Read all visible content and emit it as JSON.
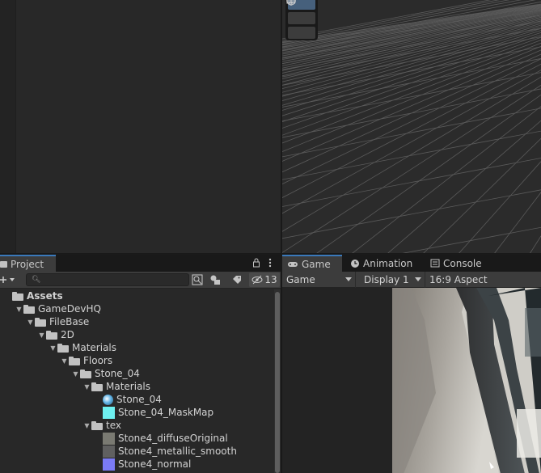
{
  "project_panel": {
    "tab_label": "Project",
    "hidden_count": "13",
    "search": {
      "value": "",
      "placeholder": ""
    },
    "tree": [
      {
        "label": "Assets",
        "depth": 0,
        "kind": "folder",
        "expanded": true,
        "bold": true
      },
      {
        "label": "GameDevHQ",
        "depth": 1,
        "kind": "folder",
        "expanded": true
      },
      {
        "label": "FileBase",
        "depth": 2,
        "kind": "folder",
        "expanded": true
      },
      {
        "label": "2D",
        "depth": 3,
        "kind": "folder",
        "expanded": true
      },
      {
        "label": "Materials",
        "depth": 4,
        "kind": "folder",
        "expanded": true
      },
      {
        "label": "Floors",
        "depth": 5,
        "kind": "folder",
        "expanded": true
      },
      {
        "label": "Stone_04",
        "depth": 6,
        "kind": "folder",
        "expanded": true
      },
      {
        "label": "Materials",
        "depth": 7,
        "kind": "folder",
        "expanded": true
      },
      {
        "label": "Stone_04",
        "depth": 8,
        "kind": "material",
        "color": "#5fb3e6"
      },
      {
        "label": "Stone_04_MaskMap",
        "depth": 8,
        "kind": "texture",
        "color": "#6ef0f0"
      },
      {
        "label": "tex",
        "depth": 7,
        "kind": "folder",
        "expanded": true
      },
      {
        "label": "Stone4_diffuseOriginal",
        "depth": 8,
        "kind": "texture",
        "color": "#7a7a72"
      },
      {
        "label": "Stone4_metallic_smooth",
        "depth": 8,
        "kind": "texture",
        "color": "#606060"
      },
      {
        "label": "Stone4_normal",
        "depth": 8,
        "kind": "texture",
        "color": "#7b7bf5"
      }
    ]
  },
  "game_panel": {
    "tabs": [
      {
        "label": "Game",
        "icon": "gamepad-icon",
        "active": true
      },
      {
        "label": "Animation",
        "icon": "clock-icon",
        "active": false
      },
      {
        "label": "Console",
        "icon": "console-icon",
        "active": false
      }
    ],
    "display_mode": "Game",
    "display": "Display 1",
    "aspect": "16:9 Aspect"
  },
  "scene_tools": [
    "rect-tool-icon",
    "rect-transform-icon",
    "transform-gizmo-icon"
  ],
  "colors": {
    "accent": "#3a79bb",
    "panel_bg": "#282828",
    "toolbar_bg": "#3c3c3c",
    "dark_bg": "#191919"
  }
}
